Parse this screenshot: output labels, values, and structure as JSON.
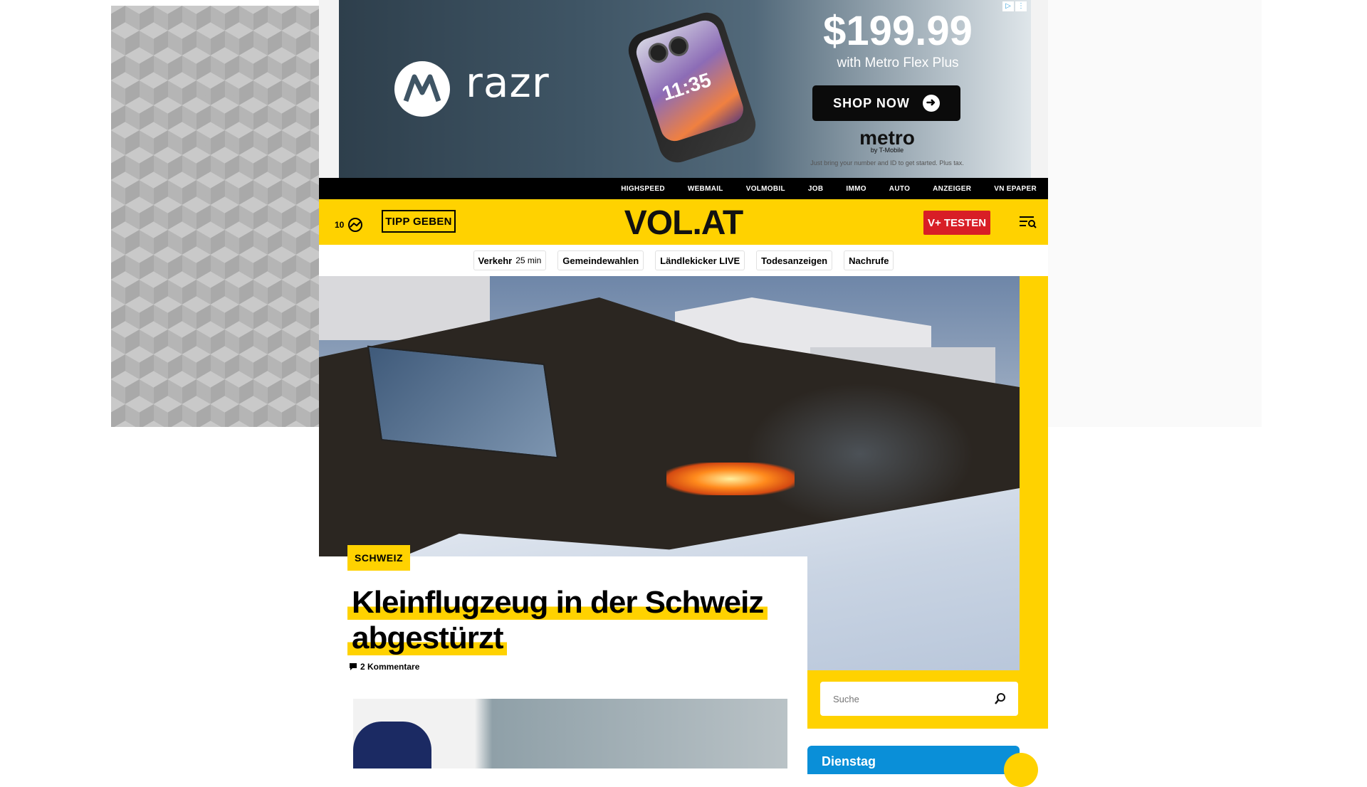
{
  "ad_top": {
    "choices": [
      "▷",
      "⋮"
    ],
    "brand": "razr",
    "phone_time": "11:35",
    "price": "$199.99",
    "subline": "with Metro Flex Plus",
    "cta": "SHOP NOW",
    "carrier": "metro",
    "carrier_sub": "by T-Mobile",
    "fine_print": "Just bring your number and ID to get started. Plus tax."
  },
  "topbar": {
    "links": [
      "HIGHSPEED",
      "WEBMAIL",
      "VOLMOBIL",
      "JOB",
      "IMMO",
      "AUTO",
      "ANZEIGER",
      "VN EPAPER"
    ]
  },
  "header": {
    "temperature": "10",
    "weather_icon": "cloud-sun-icon",
    "tip_button": "TIPP GEBEN",
    "logo": "VOL.AT",
    "plus_button": "V+ TESTEN",
    "menu_icon": "menu-search-icon",
    "accent": "#ffd200",
    "plus_color": "#d81e26"
  },
  "quicklinks": [
    {
      "label": "Verkehr",
      "extra": "25 min"
    },
    {
      "label": "Gemeindewahlen"
    },
    {
      "label": "Ländlekicker LIVE"
    },
    {
      "label": "Todesanzeigen"
    },
    {
      "label": "Nachrufe"
    }
  ],
  "article": {
    "category": "SCHWEIZ",
    "headline_line1": "Kleinflugzeug in der Schweiz",
    "headline_line2": "abgestürzt",
    "comments": "2 Kommentare",
    "comment_icon": "comment-icon"
  },
  "sidebar": {
    "search_placeholder": "Suche",
    "search_icon": "search-icon",
    "weather_day": "Dienstag"
  }
}
